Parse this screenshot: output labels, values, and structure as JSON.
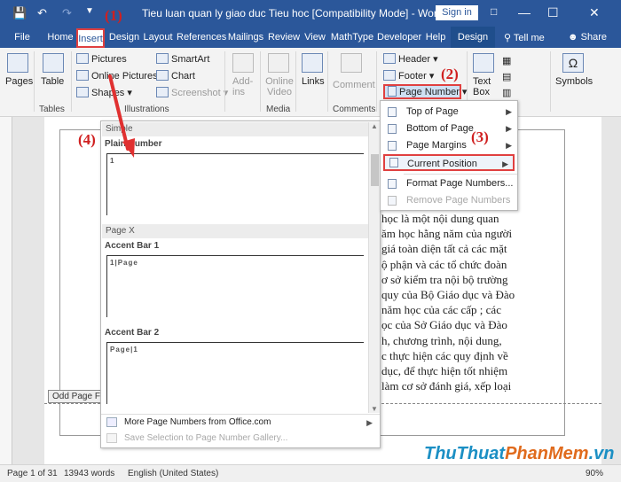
{
  "window": {
    "title": "Tieu luan quan ly giao duc Tieu hoc [Compatibility Mode] - Word",
    "sign_in": "Sign in",
    "qa_icons": [
      "save-icon",
      "undo-icon",
      "redo-icon",
      "customize-icon"
    ],
    "controls": [
      "ribbon-display-icon",
      "minimize-icon",
      "maximize-icon",
      "close-icon"
    ]
  },
  "tabs": [
    {
      "label": "File"
    },
    {
      "label": "Home"
    },
    {
      "label": "Insert"
    },
    {
      "label": "Design"
    },
    {
      "label": "Layout"
    },
    {
      "label": "References"
    },
    {
      "label": "Mailings"
    },
    {
      "label": "Review"
    },
    {
      "label": "View"
    },
    {
      "label": "MathType"
    },
    {
      "label": "Developer"
    },
    {
      "label": "Help"
    },
    {
      "label": "Design"
    }
  ],
  "tell_me": "Tell me",
  "share": "Share",
  "ribbon": {
    "pages": "Pages",
    "table": "Table",
    "pictures": "Pictures",
    "online_pictures": "Online Pictures",
    "shapes": "Shapes",
    "smartart": "SmartArt",
    "chart": "Chart",
    "screenshot": "Screenshot",
    "addins": "Add-ins",
    "online_video": "Online Video",
    "links": "Links",
    "comment": "Comment",
    "header": "Header",
    "footer": "Footer",
    "page_number": "Page Number",
    "text_box": "Text Box",
    "symbols": "Symbols",
    "groups": {
      "tables": "Tables",
      "illustrations": "Illustrations",
      "media": "Media",
      "comments": "Comments"
    }
  },
  "annotations": [
    "(1)",
    "(2)",
    "(3)",
    "(4)"
  ],
  "page_number_menu": [
    {
      "label": "Top of Page",
      "submenu": true
    },
    {
      "label": "Bottom of Page",
      "submenu": true
    },
    {
      "label": "Page Margins",
      "submenu": true
    },
    {
      "label": "Current Position",
      "submenu": true
    },
    {
      "label": "Format Page Numbers...",
      "submenu": false
    },
    {
      "label": "Remove Page Numbers",
      "submenu": false,
      "disabled": true
    }
  ],
  "gallery": {
    "section1": "Simple",
    "item1": "Plain Number",
    "item1_mark": "1",
    "section2": "Page X",
    "item2": "Accent Bar 1",
    "item2_mark": "1|Page",
    "item3": "Accent Bar 2",
    "item3_mark": "Page|1",
    "more": "More Page Numbers from Office.com",
    "save": "Save Selection to Page Number Gallery..."
  },
  "document": {
    "odd_page_footer": "Odd Page Fo",
    "lines": [
      "học là một nội dung quan",
      "ăm học hằng năm của người",
      "giá toàn diện tất cả các mặt",
      "ộ phận và các tổ chức đoàn",
      "ơ sở kiểm tra nội bộ trường",
      "quy của Bộ Giáo dục và Đào",
      " năm học của các cấp ; các",
      "ọc của Sở Giáo dục và Đào",
      "h, chương trình, nội dung,",
      "c thực hiện các quy định về",
      " dục, để thực hiện tốt nhiệm",
      "làm cơ sở đánh giá, xếp loại"
    ]
  },
  "status": {
    "page": "Page 1 of 31",
    "words": "13943 words",
    "language": "English (United States)",
    "zoom": "90%"
  },
  "watermark": {
    "part1": "ThuThuat",
    "part2": "PhanMem",
    "part3": ".vn"
  },
  "colors": {
    "word_blue": "#2b579a",
    "annotation_red": "#d02020"
  }
}
